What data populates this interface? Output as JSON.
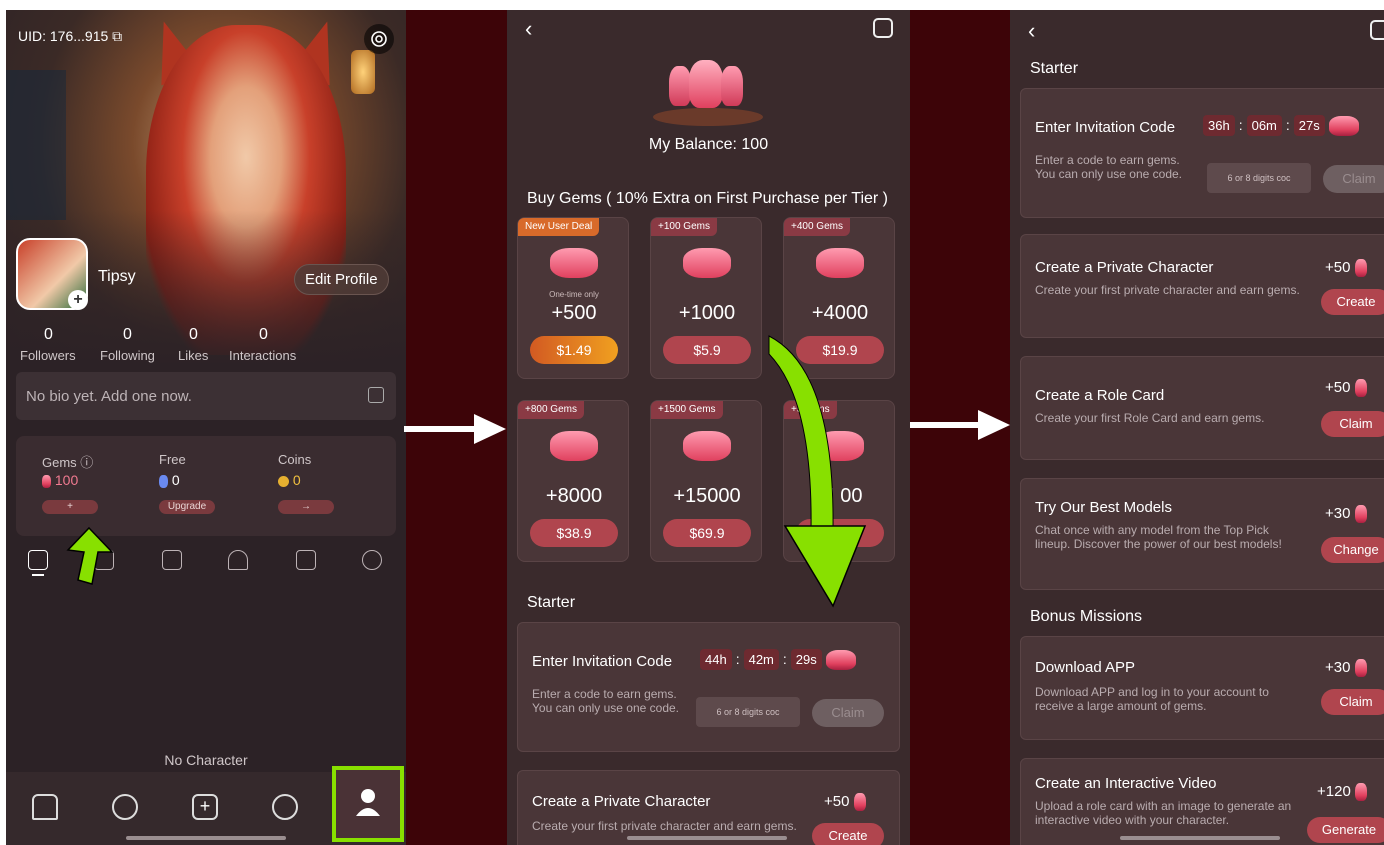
{
  "panel1": {
    "uid": "UID: 176...915",
    "username": "Tipsy",
    "edit_profile": "Edit Profile",
    "stats": [
      {
        "value": "0",
        "label": "Followers"
      },
      {
        "value": "0",
        "label": "Following"
      },
      {
        "value": "0",
        "label": "Likes"
      },
      {
        "value": "0",
        "label": "Interactions"
      }
    ],
    "bio_placeholder": "No bio yet. Add one now.",
    "wallet": {
      "gems_label": "Gems",
      "gems_value": "100",
      "gems_btn": "+",
      "free_label": "Free",
      "free_value": "0",
      "free_btn": "Upgrade",
      "coins_label": "Coins",
      "coins_value": "0",
      "coins_btn": "→"
    },
    "no_character": "No Character"
  },
  "panel2": {
    "balance": "My Balance: 100",
    "buy_title": "Buy Gems ( 10% Extra on First Purchase per Tier )",
    "cards": [
      {
        "tag": "New User Deal",
        "note": "One-time only",
        "amount": "+500",
        "price": "$1.49"
      },
      {
        "tag": "+100 Gems",
        "amount": "+1000",
        "price": "$5.9"
      },
      {
        "tag": "+400 Gems",
        "amount": "+4000",
        "price": "$19.9"
      },
      {
        "tag": "+800 Gems",
        "amount": "+8000",
        "price": "$38.9"
      },
      {
        "tag": "+1500 Gems",
        "amount": "+15000",
        "price": "$69.9"
      },
      {
        "tag": "+50  ems",
        "amount": "+!    00",
        "price": "  .9"
      }
    ],
    "starter_title": "Starter",
    "invite": {
      "title": "Enter Invitation Code",
      "h": "44h",
      "m": "42m",
      "s": "29s",
      "desc": "Enter a code to earn gems. You can only use one code.",
      "placeholder": "6 or 8 digits coc",
      "claim": "Claim"
    },
    "private": {
      "title": "Create a Private Character",
      "reward": "+50",
      "desc": "Create your first private character and earn gems.",
      "btn": "Create"
    }
  },
  "panel3": {
    "starter_title": "Starter",
    "invite": {
      "title": "Enter Invitation Code",
      "h": "36h",
      "m": "06m",
      "s": "27s",
      "desc": "Enter a code to earn gems. You can only use one code.",
      "placeholder": "6 or 8 digits coc",
      "claim": "Claim"
    },
    "tasks": [
      {
        "title": "Create a Private Character",
        "reward": "+50",
        "desc": "Create your first private character and earn gems.",
        "btn": "Create"
      },
      {
        "title": "Create a Role Card",
        "reward": "+50",
        "desc": "Create your first Role Card and earn gems.",
        "btn": "Claim"
      },
      {
        "title": "Try Our Best Models",
        "reward": "+30",
        "desc": "Chat once with any model from the Top Pick lineup. Discover the power of our best models!",
        "btn": "Change"
      }
    ],
    "bonus_title": "Bonus Missions",
    "bonus": [
      {
        "title": "Download APP",
        "reward": "+30",
        "desc": "Download APP and log in to your account to receive a large amount of gems.",
        "btn": "Claim"
      },
      {
        "title": "Create an Interactive Video",
        "reward": "+120",
        "desc": "Upload a role card with an image to generate an interactive video with your character.",
        "btn": "Generate"
      }
    ]
  },
  "colors": {
    "accent_green": "#88e000",
    "dark_red_bg": "#3d0408",
    "button_red": "#b0454e"
  }
}
